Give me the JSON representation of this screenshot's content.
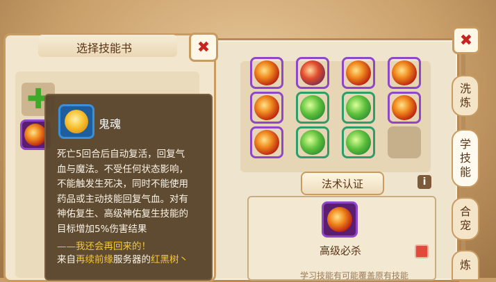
{
  "left_panel": {
    "title": "选择技能书",
    "close_symbol": "✖"
  },
  "tooltip": {
    "skill_name": "鬼魂",
    "description_lines": [
      "死亡5回合后自动复活，回复气",
      "血与魔法。不受任何状态影响，",
      "不能触发生死决，同时不能使用",
      "药品或主动技能回复气血。对有",
      "神佑复生、高级神佑复生技能的",
      "目标增加5%伤害结果"
    ],
    "quote": "——我还会再回来的！",
    "source_prefix": "来自",
    "source_server": "再续前缘",
    "source_middle": "服务器的",
    "source_player": "红黑树丶"
  },
  "right_panel": {
    "close_symbol": "✖",
    "certify_button": "法术认证",
    "info_symbol": "i",
    "selected_skill_name": "高级必杀",
    "hint_text": "学习技能有可能覆盖原有技能"
  },
  "side_tabs": [
    {
      "label_1": "洗",
      "label_2": "炼"
    },
    {
      "label_1": "学",
      "label_2": "技",
      "label_3": "能"
    },
    {
      "label_1": "合",
      "label_2": "宠"
    },
    {
      "label_1": "炼"
    }
  ],
  "skill_grid": {
    "rows": [
      [
        "red",
        "mixed",
        "red",
        "red"
      ],
      [
        "red",
        "green",
        "green",
        "red"
      ],
      [
        "red",
        "green",
        "green",
        "empty"
      ]
    ]
  },
  "icons": {
    "add_slot": "plus-icon",
    "owned_skill": "fire-orb-icon",
    "tooltip_skill": "ghost-icon"
  }
}
